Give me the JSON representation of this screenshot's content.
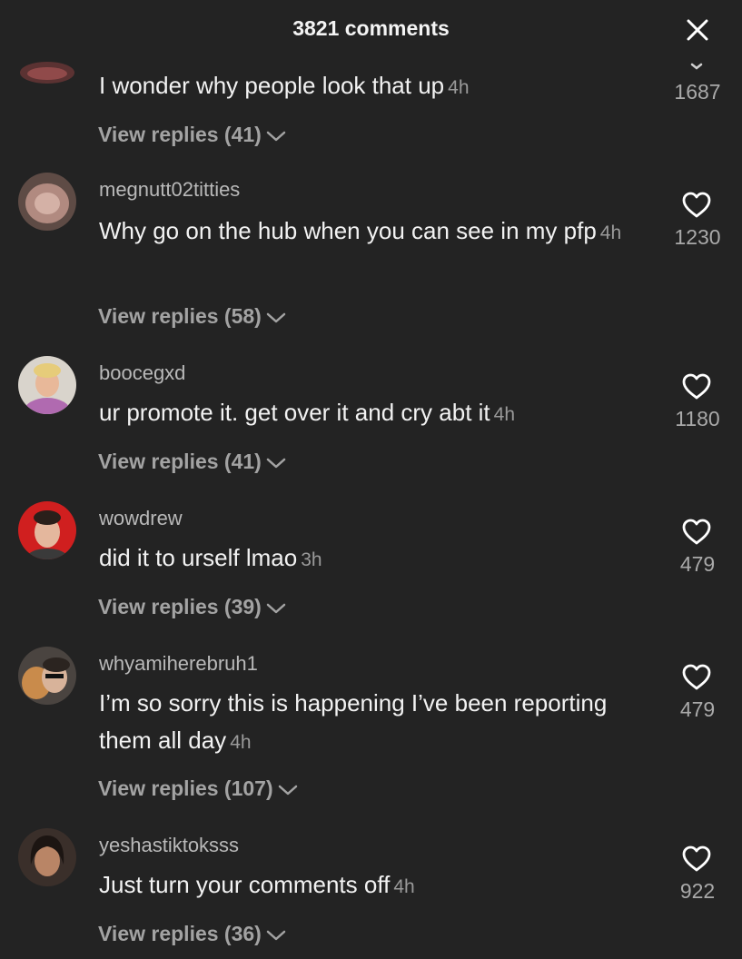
{
  "header": {
    "title": "3821 comments"
  },
  "icons": {
    "close": "close-icon",
    "like": "heart-outline-icon",
    "expand": "chevron-down-icon"
  },
  "comments": [
    {
      "username": "",
      "text": "I wonder why people look that up",
      "time": "4h",
      "likes": "1687",
      "replies": "View replies (41)"
    },
    {
      "username": "megnutt02titties",
      "text": "Why go on the hub when you can see in my pfp",
      "time": "4h",
      "likes": "1230",
      "replies": "View replies (58)"
    },
    {
      "username": "boocegxd",
      "text": "ur promote it. get over it and cry abt it",
      "time": "4h",
      "likes": "1180",
      "replies": "View replies (41)"
    },
    {
      "username": "wowdrew",
      "text": "did it to urself lmao",
      "time": "3h",
      "likes": "479",
      "replies": "View replies (39)"
    },
    {
      "username": "whyamiherebruh1",
      "text": "I’m so sorry this is happening I’ve been reporting them all day",
      "time": "4h",
      "likes": "479",
      "replies": "View replies (107)"
    },
    {
      "username": "yeshastiktoksss",
      "text": "Just turn your comments off",
      "time": "4h",
      "likes": "922",
      "replies": "View replies (36)"
    }
  ]
}
